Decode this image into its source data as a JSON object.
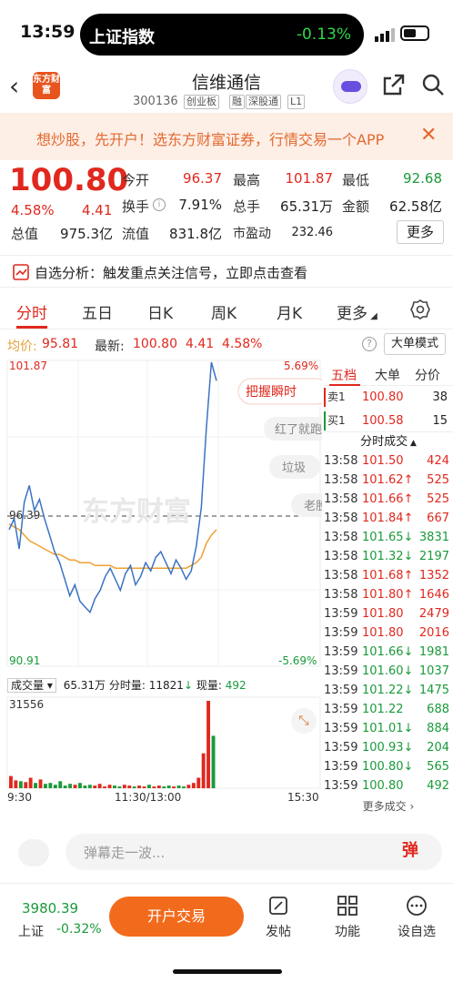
{
  "status_bar": {
    "time": "13:59",
    "index_name": "上证指数",
    "index_change": "-0.13%"
  },
  "header": {
    "logo_text": "东方财富",
    "stock_name": "信维通信",
    "stock_code": "300136",
    "tags": [
      "创业板",
      "融",
      "深股通",
      "L1"
    ]
  },
  "promo": {
    "text": "想炒股，先开户！选东方财富证券，行情交易一个APP"
  },
  "quote": {
    "price": "100.80",
    "change_pct": "4.58%",
    "change": "4.41",
    "row1": [
      {
        "label": "今开",
        "value": "96.37",
        "color": "#e0281e"
      },
      {
        "label": "最高",
        "value": "101.87",
        "color": "#e0281e"
      },
      {
        "label": "最低",
        "value": "92.68",
        "color": "#1a9a3a"
      }
    ],
    "row2": [
      {
        "label": "换手",
        "value": "7.91%",
        "color": "#222"
      },
      {
        "label": "总手",
        "value": "65.31万",
        "color": "#222"
      },
      {
        "label": "金额",
        "value": "62.58亿",
        "color": "#222"
      }
    ],
    "row3": [
      {
        "label": "总值",
        "value": "975.3亿",
        "color": "#222"
      },
      {
        "label": "流值",
        "value": "831.8亿",
        "color": "#222"
      },
      {
        "label": "市盈动",
        "value": "232.46",
        "color": "#222"
      }
    ],
    "more_label": "更多"
  },
  "alert": {
    "text": "自选分析：触发重点关注信号，立即点击查看"
  },
  "tabs": [
    "分时",
    "五日",
    "日K",
    "周K",
    "月K",
    "更多"
  ],
  "avg_bar": {
    "avg_label": "均价:",
    "avg_value": "95.81",
    "latest_label": "最新:",
    "latest_value": "100.80",
    "change": "4.41",
    "change_pct": "4.58%",
    "big_order_btn": "大单模式"
  },
  "chart_labels": {
    "y_top": "101.87",
    "y_bottom": "90.91",
    "y_mid": "96.39",
    "pct_top": "5.69%",
    "pct_bottom": "-5.69%",
    "x_start": "9:30",
    "x_mid": "11:30/13:00",
    "x_end": "15:30",
    "watermark": "东方财富",
    "bubble1": "把握瞬时",
    "bubble2": "红了就跑",
    "bubble3": "垃圾",
    "bubble4": "老股"
  },
  "volume": {
    "label": "成交量",
    "total": "65.31万",
    "period_label": "分时量:",
    "period_value": "11821",
    "current_label": "现量:",
    "current_value": "492",
    "max": "31556"
  },
  "chart_data": {
    "type": "line",
    "ylim": [
      90.91,
      101.87
    ],
    "series": [
      {
        "name": "price",
        "values": [
          95.8,
          96.2,
          95.1,
          96.8,
          97.4,
          96.5,
          96.9,
          96.2,
          95.6,
          95.0,
          94.6,
          94.0,
          93.4,
          93.8,
          93.2,
          93.0,
          92.8,
          93.3,
          93.6,
          94.1,
          94.4,
          94.0,
          93.6,
          94.2,
          94.5,
          93.8,
          94.1,
          94.6,
          94.3,
          94.8,
          95.0,
          94.6,
          94.2,
          94.7,
          94.4,
          94.0,
          94.3,
          95.2,
          96.6,
          99.5,
          101.87,
          101.2
        ]
      },
      {
        "name": "avg",
        "values": [
          96.0,
          95.9,
          95.8,
          95.6,
          95.4,
          95.3,
          95.2,
          95.1,
          95.0,
          94.9,
          94.9,
          94.8,
          94.7,
          94.7,
          94.6,
          94.6,
          94.6,
          94.5,
          94.5,
          94.5,
          94.5,
          94.4,
          94.4,
          94.4,
          94.4,
          94.4,
          94.4,
          94.4,
          94.4,
          94.4,
          94.4,
          94.4,
          94.4,
          94.4,
          94.4,
          94.4,
          94.5,
          94.6,
          94.8,
          95.3,
          95.6,
          95.8
        ]
      }
    ],
    "volume": [
      14,
      9,
      8,
      7,
      12,
      6,
      10,
      5,
      6,
      4,
      8,
      3,
      5,
      4,
      6,
      3,
      4,
      3,
      5,
      2,
      4,
      3,
      2,
      4,
      3,
      2,
      3,
      2,
      4,
      2,
      3,
      2,
      3,
      2,
      3,
      2,
      4,
      6,
      12,
      40,
      100,
      60
    ]
  },
  "right_panel": {
    "tabs": [
      "五档",
      "大单",
      "分价"
    ],
    "sell1": {
      "label": "卖1",
      "price": "100.80",
      "vol": "38"
    },
    "buy1": {
      "label": "买1",
      "price": "100.58",
      "vol": "15"
    },
    "ticks_title": "分时成交",
    "ticks": [
      {
        "t": "13:58",
        "p": "101.50",
        "a": "",
        "v": "424",
        "c": "#e0281e"
      },
      {
        "t": "13:58",
        "p": "101.62",
        "a": "↑",
        "v": "525",
        "c": "#e0281e"
      },
      {
        "t": "13:58",
        "p": "101.66",
        "a": "↑",
        "v": "525",
        "c": "#e0281e"
      },
      {
        "t": "13:58",
        "p": "101.84",
        "a": "↑",
        "v": "667",
        "c": "#e0281e"
      },
      {
        "t": "13:58",
        "p": "101.65",
        "a": "↓",
        "v": "3831",
        "c": "#1a9a3a"
      },
      {
        "t": "13:58",
        "p": "101.32",
        "a": "↓",
        "v": "2197",
        "c": "#1a9a3a"
      },
      {
        "t": "13:58",
        "p": "101.68",
        "a": "↑",
        "v": "1352",
        "c": "#e0281e"
      },
      {
        "t": "13:58",
        "p": "101.80",
        "a": "↑",
        "v": "1646",
        "c": "#e0281e"
      },
      {
        "t": "13:59",
        "p": "101.80",
        "a": "",
        "v": "2479",
        "c": "#e0281e"
      },
      {
        "t": "13:59",
        "p": "101.80",
        "a": "",
        "v": "2016",
        "c": "#e0281e"
      },
      {
        "t": "13:59",
        "p": "101.66",
        "a": "↓",
        "v": "1981",
        "c": "#1a9a3a"
      },
      {
        "t": "13:59",
        "p": "101.60",
        "a": "↓",
        "v": "1037",
        "c": "#1a9a3a"
      },
      {
        "t": "13:59",
        "p": "101.22",
        "a": "↓",
        "v": "1475",
        "c": "#1a9a3a"
      },
      {
        "t": "13:59",
        "p": "101.22",
        "a": "",
        "v": "688",
        "c": "#1a9a3a"
      },
      {
        "t": "13:59",
        "p": "101.01",
        "a": "↓",
        "v": "884",
        "c": "#1a9a3a"
      },
      {
        "t": "13:59",
        "p": "100.93",
        "a": "↓",
        "v": "204",
        "c": "#1a9a3a"
      },
      {
        "t": "13:59",
        "p": "100.80",
        "a": "↓",
        "v": "565",
        "c": "#1a9a3a"
      },
      {
        "t": "13:59",
        "p": "100.80",
        "a": "",
        "v": "492",
        "c": "#1a9a3a"
      }
    ],
    "more_ticks": "更多成交"
  },
  "danmu": {
    "placeholder": "弹幕走一波...",
    "button": "弹"
  },
  "bottom": {
    "index_value": "3980.39",
    "index_name": "上证",
    "index_change": "-0.32%",
    "open_btn": "开户交易",
    "items": [
      "发帖",
      "功能",
      "设自选"
    ]
  }
}
